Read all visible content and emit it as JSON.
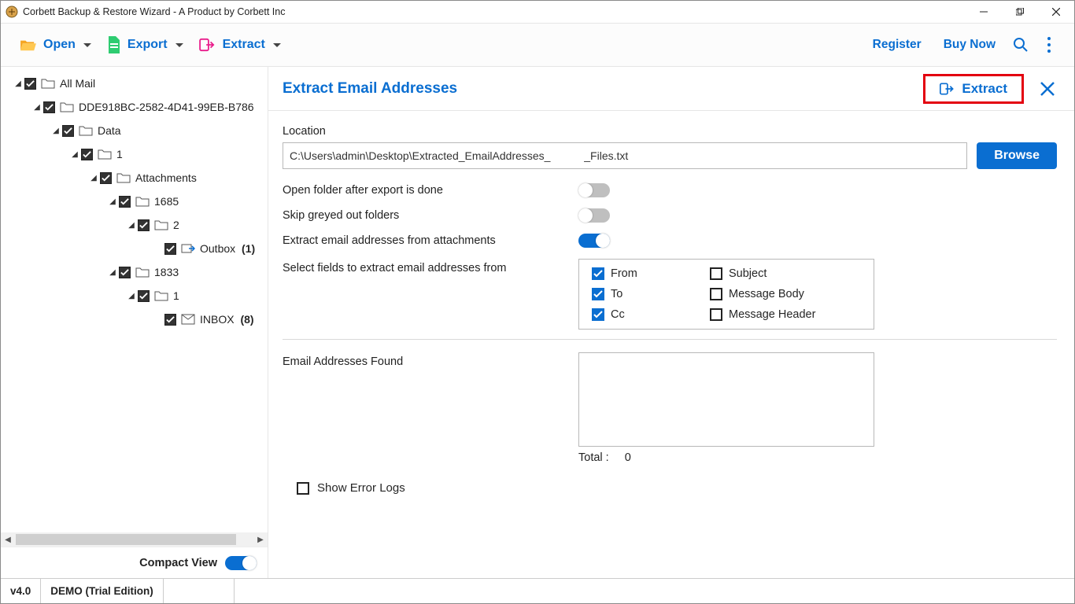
{
  "title": "Corbett Backup & Restore Wizard - A Product by Corbett Inc",
  "toolbar": {
    "open": "Open",
    "export": "Export",
    "extract": "Extract",
    "register": "Register",
    "buy_now": "Buy Now"
  },
  "tree": {
    "nodes": [
      {
        "indent": 16,
        "exp": "◢",
        "label": "All Mail",
        "iconType": "folder"
      },
      {
        "indent": 40,
        "exp": "◢",
        "label": "DDE918BC-2582-4D41-99EB-B786",
        "iconType": "folder"
      },
      {
        "indent": 64,
        "exp": "◢",
        "label": "Data",
        "iconType": "folder"
      },
      {
        "indent": 88,
        "exp": "◢",
        "label": "1",
        "iconType": "folder"
      },
      {
        "indent": 112,
        "exp": "◢",
        "label": "Attachments",
        "iconType": "folder"
      },
      {
        "indent": 136,
        "exp": "◢",
        "label": "1685",
        "iconType": "folder"
      },
      {
        "indent": 160,
        "exp": "◢",
        "label": "2",
        "iconType": "folder"
      },
      {
        "indent": 194,
        "exp": "",
        "label": "Outbox",
        "iconType": "outbox",
        "count": "(1)"
      },
      {
        "indent": 136,
        "exp": "◢",
        "label": "1833",
        "iconType": "folder"
      },
      {
        "indent": 160,
        "exp": "◢",
        "label": "1",
        "iconType": "folder"
      },
      {
        "indent": 194,
        "exp": "",
        "label": "INBOX",
        "iconType": "inbox",
        "count": "(8)"
      }
    ]
  },
  "sidebar": {
    "compact_view": "Compact View",
    "compact_on": true
  },
  "panel": {
    "title": "Extract Email Addresses",
    "extract": "Extract",
    "location_label": "Location",
    "location_value": "C:\\Users\\admin\\Desktop\\Extracted_EmailAddresses_           _Files.txt",
    "browse": "Browse",
    "options": [
      {
        "label": "Open folder after export is done",
        "on": false
      },
      {
        "label": "Skip greyed out folders",
        "on": false
      },
      {
        "label": "Extract email addresses from attachments",
        "on": true
      }
    ],
    "fields_label": "Select fields to extract email addresses from",
    "fields": [
      {
        "label": "From",
        "checked": true
      },
      {
        "label": "Subject",
        "checked": false
      },
      {
        "label": "To",
        "checked": true
      },
      {
        "label": "Message Body",
        "checked": false
      },
      {
        "label": "Cc",
        "checked": true
      },
      {
        "label": "Message Header",
        "checked": false
      }
    ],
    "found_label": "Email Addresses Found",
    "total_label": "Total :",
    "total_value": "0",
    "show_error_logs": "Show Error Logs"
  },
  "status": {
    "version": "v4.0",
    "edition": "DEMO (Trial Edition)"
  }
}
